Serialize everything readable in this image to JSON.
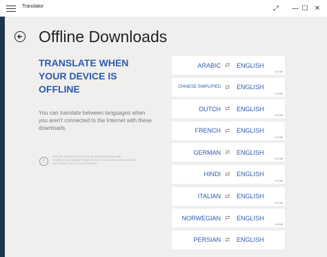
{
  "window": {
    "app_title": "Translator",
    "buttons": {
      "fullscreen": "⤢",
      "minimize": "—",
      "maximize": "☐",
      "close": "✕"
    }
  },
  "page": {
    "title": "Offline Downloads",
    "headline": "TRANSLATE WHEN YOUR DEVICE IS OFFLINE",
    "description": "You can translate between languages when you aren't connected to the Internet with these downloads.",
    "note": "Offline translation is not as accurate as online translation. Online translation is only used when you are not connected to the Internet."
  },
  "packs": [
    {
      "source": "ARABIC",
      "target": "ENGLISH",
      "size": "102 MB"
    },
    {
      "source": "CHINESE SIMPLIFIED",
      "target": "ENGLISH",
      "size": "143 MB"
    },
    {
      "source": "DUTCH",
      "target": "ENGLISH",
      "size": "116 MB"
    },
    {
      "source": "FRENCH",
      "target": "ENGLISH",
      "size": "118 MB"
    },
    {
      "source": "GERMAN",
      "target": "ENGLISH",
      "size": "122 MB"
    },
    {
      "source": "HINDI",
      "target": "ENGLISH",
      "size": "110 MB"
    },
    {
      "source": "ITALIAN",
      "target": "ENGLISH",
      "size": "115 MB"
    },
    {
      "source": "NORWEGIAN",
      "target": "ENGLISH",
      "size": "108 MB"
    },
    {
      "source": "PERSIAN",
      "target": "ENGLISH",
      "size": "104 MB"
    }
  ],
  "icons": {
    "swap": "⇄",
    "back": "arrow-left-icon",
    "warning": "!"
  },
  "colors": {
    "accent": "#2b5aad",
    "background": "#f0efee",
    "card": "#ffffff"
  }
}
